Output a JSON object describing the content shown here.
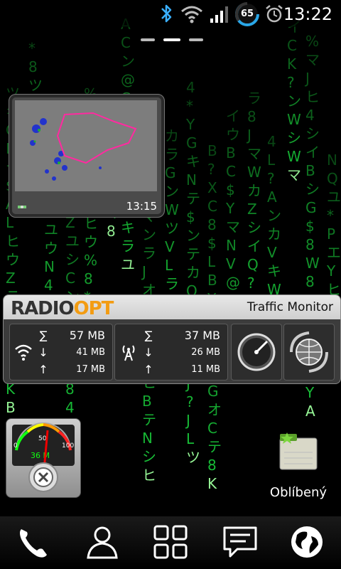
{
  "status_bar": {
    "time": "13:22",
    "battery_level": "65",
    "icons": [
      "bluetooth-icon",
      "wifi-icon",
      "signal-icon",
      "battery-icon",
      "alarm-icon"
    ]
  },
  "home": {
    "page_indicator": {
      "pages": 3,
      "current": 2
    }
  },
  "radar_widget": {
    "time": "13:15"
  },
  "traffic_monitor": {
    "brand_left": "RADIO",
    "brand_right": "OPT",
    "title": "Traffic Monitor",
    "wifi": {
      "total": "57 MB",
      "down": "41 MB",
      "up": "17 MB"
    },
    "mobile": {
      "total": "37 MB",
      "down": "26 MB",
      "up": "11 MB"
    },
    "symbols": {
      "total": "∑",
      "down": "↓",
      "up": "↑"
    }
  },
  "gauge_widget": {
    "ticks": [
      "0",
      "50",
      "100"
    ],
    "value_text": "36 M"
  },
  "shortcut": {
    "label": "Oblíbený"
  },
  "dock": {
    "items": [
      "phone-icon",
      "contacts-icon",
      "apps-grid-icon",
      "messaging-icon",
      "browser-globe-icon"
    ]
  },
  "colors": {
    "matrix_green": "#19c93a",
    "brand_orange": "#f39c12",
    "battery_ring": "#2aa7e8"
  }
}
